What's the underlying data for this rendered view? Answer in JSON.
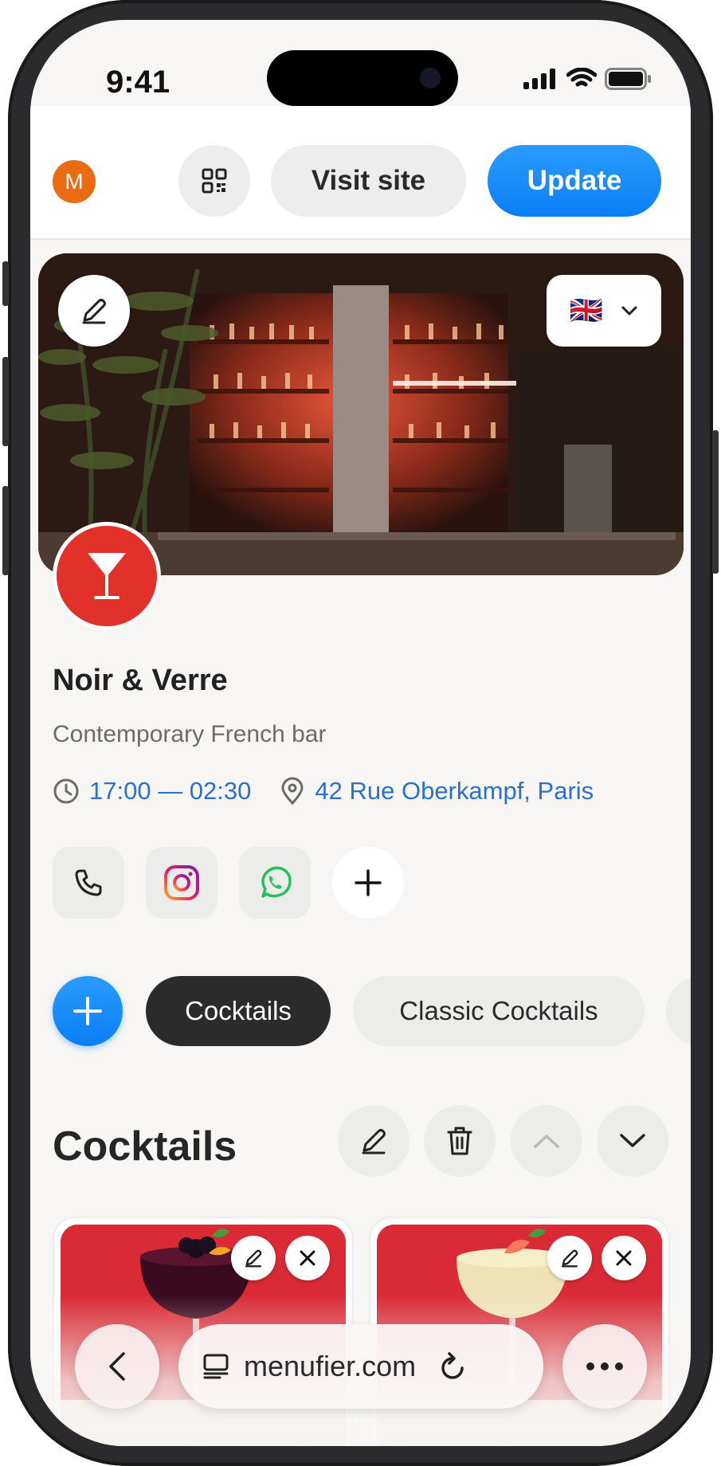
{
  "status_bar": {
    "time": "9:41"
  },
  "header": {
    "avatar_initial": "M",
    "visit_label": "Visit site",
    "update_label": "Update"
  },
  "venue": {
    "name": "Noir & Verre",
    "description": "Contemporary French bar",
    "hours": "17:00 — 02:30",
    "address": "42 Rue Oberkampf, Paris",
    "language_flag": "🇬🇧"
  },
  "contacts": [
    "phone-icon",
    "instagram-icon",
    "whatsapp-icon",
    "plus-icon"
  ],
  "categories": {
    "items": [
      {
        "label": "Cocktails",
        "active": true
      },
      {
        "label": "Classic Cocktails",
        "active": false
      }
    ]
  },
  "section": {
    "title": "Cocktails"
  },
  "browser": {
    "url": "menufier.com"
  },
  "colors": {
    "accent": "#0a7ff5",
    "link": "#2a6fd4",
    "logo_bg": "#e2312a",
    "avatar_bg": "#ea6b12",
    "chip_active_bg": "#2b2b2b"
  }
}
